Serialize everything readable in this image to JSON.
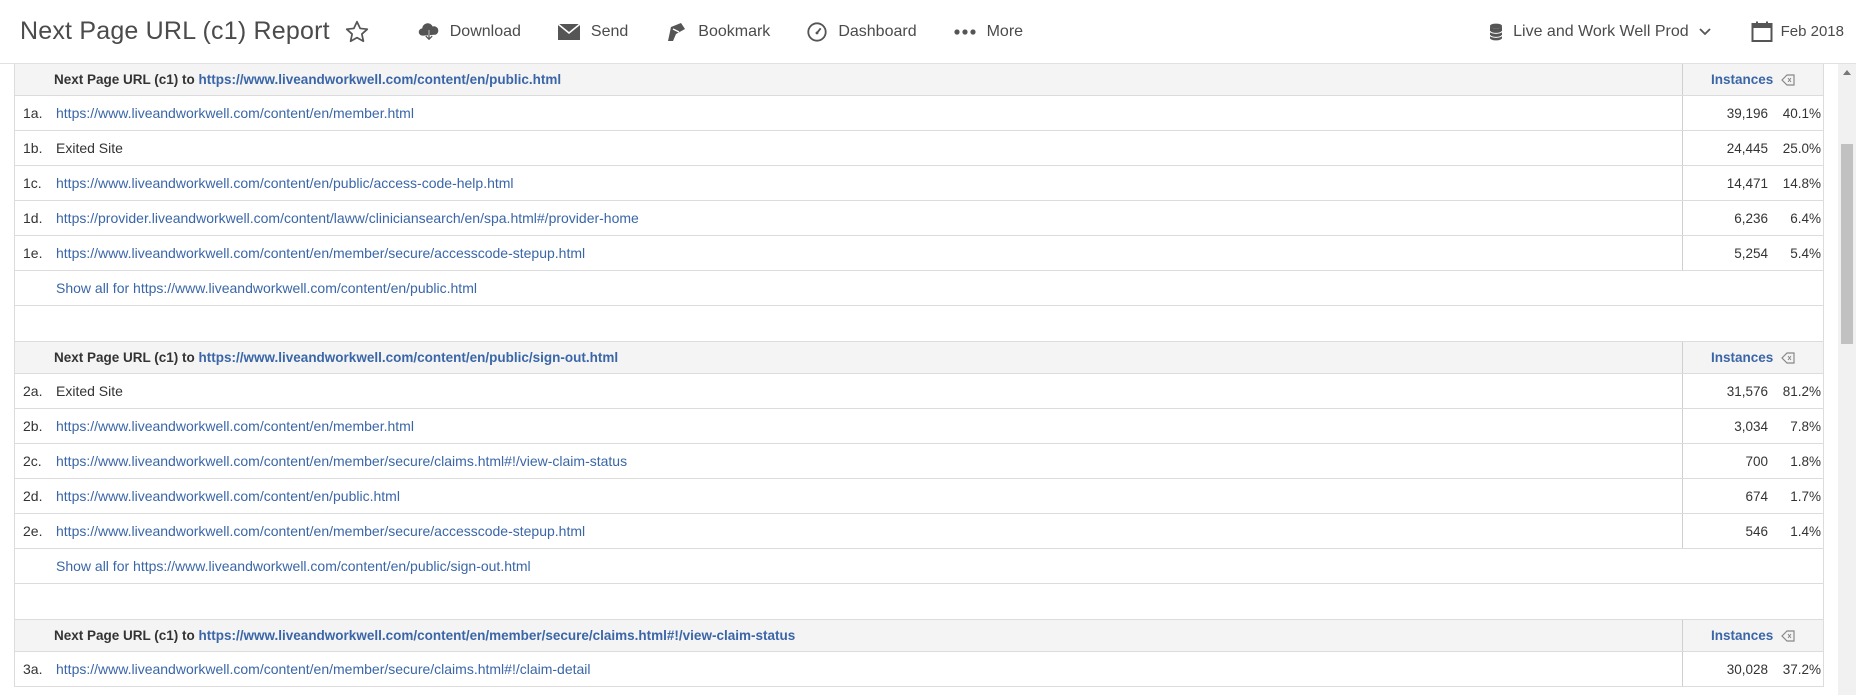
{
  "header": {
    "title": "Next Page URL (c1) Report",
    "toolbar": {
      "download": "Download",
      "send": "Send",
      "bookmark": "Bookmark",
      "dashboard": "Dashboard",
      "more": "More"
    },
    "report_suite": "Live and Work Well Prod",
    "date_range": "Feb 2018"
  },
  "sections": [
    {
      "head_prefix": "Next Page URL (c1) to",
      "head_url": "https://www.liveandworkwell.com/content/en/public.html",
      "metric": "Instances",
      "rows": [
        {
          "num": "1a.",
          "label": "https://www.liveandworkwell.com/content/en/member.html",
          "count": "39,196",
          "pct": "40.1%"
        },
        {
          "num": "1b.",
          "label": "Exited Site",
          "count": "24,445",
          "pct": "25.0%"
        },
        {
          "num": "1c.",
          "label": "https://www.liveandworkwell.com/content/en/public/access-code-help.html",
          "count": "14,471",
          "pct": "14.8%"
        },
        {
          "num": "1d.",
          "label": "https://provider.liveandworkwell.com/content/laww/cliniciansearch/en/spa.html#/provider-home",
          "count": "6,236",
          "pct": "6.4%"
        },
        {
          "num": "1e.",
          "label": "https://www.liveandworkwell.com/content/en/member/secure/accesscode-stepup.html",
          "count": "5,254",
          "pct": "5.4%"
        }
      ],
      "show_all": "Show all for https://www.liveandworkwell.com/content/en/public.html"
    },
    {
      "head_prefix": "Next Page URL (c1) to",
      "head_url": "https://www.liveandworkwell.com/content/en/public/sign-out.html",
      "metric": "Instances",
      "rows": [
        {
          "num": "2a.",
          "label": "Exited Site",
          "count": "31,576",
          "pct": "81.2%"
        },
        {
          "num": "2b.",
          "label": "https://www.liveandworkwell.com/content/en/member.html",
          "count": "3,034",
          "pct": "7.8%"
        },
        {
          "num": "2c.",
          "label": "https://www.liveandworkwell.com/content/en/member/secure/claims.html#!/view-claim-status",
          "count": "700",
          "pct": "1.8%"
        },
        {
          "num": "2d.",
          "label": "https://www.liveandworkwell.com/content/en/public.html",
          "count": "674",
          "pct": "1.7%"
        },
        {
          "num": "2e.",
          "label": "https://www.liveandworkwell.com/content/en/member/secure/accesscode-stepup.html",
          "count": "546",
          "pct": "1.4%"
        }
      ],
      "show_all": "Show all for https://www.liveandworkwell.com/content/en/public/sign-out.html"
    },
    {
      "head_prefix": "Next Page URL (c1) to",
      "head_url": "https://www.liveandworkwell.com/content/en/member/secure/claims.html#!/view-claim-status",
      "metric": "Instances",
      "rows": [
        {
          "num": "3a.",
          "label": "https://www.liveandworkwell.com/content/en/member/secure/claims.html#!/claim-detail",
          "count": "30,028",
          "pct": "37.2%"
        }
      ]
    }
  ],
  "colors": {
    "link": "#3a66a8",
    "text": "#333333",
    "header_bg": "#f4f4f4"
  }
}
